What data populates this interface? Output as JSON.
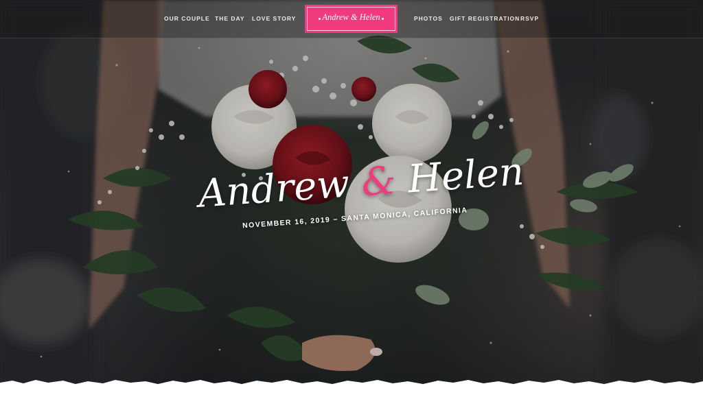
{
  "nav": {
    "left_items": [
      {
        "label": "OUR COUPLE"
      },
      {
        "label": "THE DAY"
      },
      {
        "label": "LOVE STORY"
      }
    ],
    "logo": {
      "text": "Andrew & Helen"
    },
    "right_items": [
      {
        "label": "PHOTOS"
      },
      {
        "label": "GIFT REGISTRATION"
      },
      {
        "label": "RSVP"
      }
    ]
  },
  "hero": {
    "name_one": "Andrew",
    "ampersand": "&",
    "name_two": "Helen",
    "subtitle": "NOVEMBER 16, 2019 – SANTA MONICA, CALIFORNIA",
    "image_description_icon": "bridal-bouquet-photo"
  },
  "colors": {
    "accent_pink": "#f23b7e",
    "text_white": "#ffffff",
    "page_background": "#ffffff"
  }
}
